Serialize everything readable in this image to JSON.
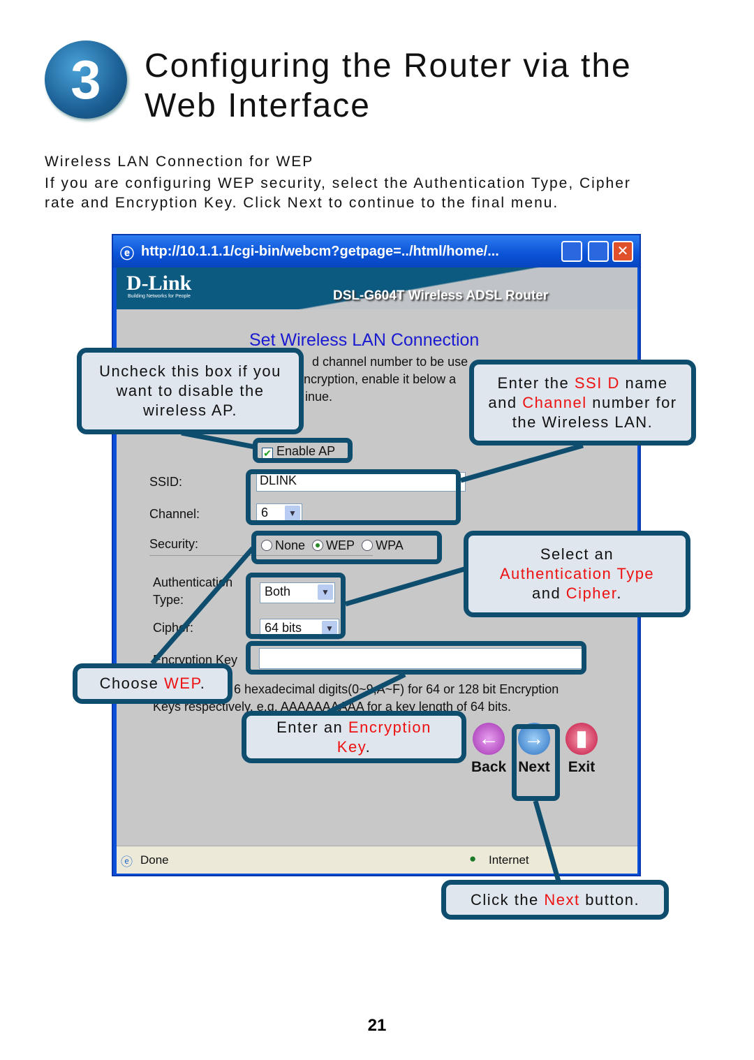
{
  "section_number": "3",
  "title_line1": "Configuring the Router via the",
  "title_line2": "Web Interface",
  "subheading": "Wireless LAN Connection for WEP",
  "intro_line1": "If you are configuring WEP security, select the Authentication Type, Cipher",
  "intro_line2": "rate and Encryption Key. Click Next to continue to the final menu.",
  "browser": {
    "title": "http://10.1.1.1/cgi-bin/webcm?getpage=../html/home/...",
    "logo": "D-Link",
    "logo_tagline": "Building Networks for People",
    "model": "DSL-G604T Wireless ADSL Router",
    "page_title": "Set Wireless LAN Connection",
    "desc_fragments": [
      "d channel number to be use",
      "ncryption, enable it below a",
      "inue."
    ],
    "enable_ap_label": "Enable AP",
    "enable_ap_checked": true,
    "ssid_label": "SSID:",
    "ssid_value": "DLINK",
    "channel_label": "Channel:",
    "channel_value": "6",
    "security_label": "Security:",
    "security_options": [
      "None",
      "WEP",
      "WPA"
    ],
    "security_selected": "WEP",
    "auth_label_1": "Authentication",
    "auth_label_2": "Type:",
    "auth_value": "Both",
    "cipher_label": "Cipher:",
    "cipher_value": "64 bits",
    "key_label": "Encryption Key",
    "key_value": "",
    "hint_line1": "6 hexadecimal digits(0~9,A~F) for 64 or 128 bit Encryption",
    "hint_line2": "Keys respectively, e.g. AAAAAAAAAA for a key length of 64 bits.",
    "back": "Back",
    "next": "Next",
    "exit": "Exit",
    "status_done": "Done",
    "status_zone": "Internet"
  },
  "callouts": {
    "enable": "Uncheck this box if you want to disable the wireless AP.",
    "ssid_pre": "Enter the ",
    "ssid_red1": "SSI D",
    "ssid_mid": " name and ",
    "ssid_red2": "Channel",
    "ssid_post": " number for the Wireless LAN.",
    "auth_pre": "Select an",
    "auth_red1": "Authentication Type",
    "auth_mid": "and ",
    "auth_red2": "Cipher",
    "auth_post": ".",
    "wep_pre": "Choose ",
    "wep_red": "WEP",
    "wep_post": ".",
    "key_pre": "Enter an ",
    "key_red": "Encryption Key",
    "key_post": ".",
    "next_pre": "Click the ",
    "next_red": "Next",
    "next_post": " button."
  },
  "colors": {
    "callout_border": "#0e4d6e",
    "callout_fill": "#dfe6ee",
    "highlight_red": "#ee1111",
    "link_blue": "#1a1ad0"
  },
  "page_number": "21"
}
